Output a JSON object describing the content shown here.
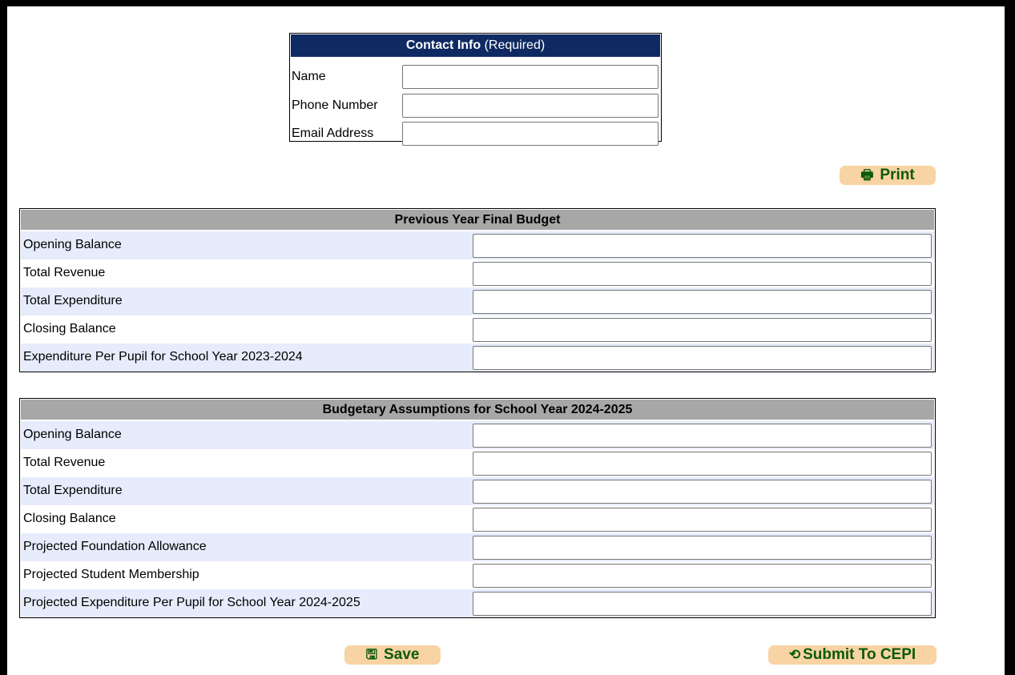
{
  "contact": {
    "title_bold": "Contact Info",
    "title_note": "(Required)",
    "fields": [
      {
        "label": "Name",
        "value": ""
      },
      {
        "label": "Phone Number",
        "value": ""
      },
      {
        "label": "Email Address",
        "value": ""
      }
    ]
  },
  "buttons": {
    "print": {
      "icon": "printer-icon",
      "label": "Print"
    },
    "save": {
      "icon": "floppy-disk-icon",
      "label": "Save"
    },
    "submit": {
      "icon": "refresh-arrow-icon",
      "label": "Submit To CEPI"
    }
  },
  "previous_year": {
    "title": "Previous Year Final Budget",
    "rows": [
      {
        "label": "Opening Balance",
        "value": ""
      },
      {
        "label": "Total Revenue",
        "value": ""
      },
      {
        "label": "Total Expenditure",
        "value": ""
      },
      {
        "label": "Closing Balance",
        "value": ""
      },
      {
        "label": "Expenditure Per Pupil for School Year 2023-2024",
        "value": ""
      }
    ]
  },
  "assumptions": {
    "title": "Budgetary Assumptions for School Year 2024-2025",
    "rows": [
      {
        "label": "Opening Balance",
        "value": ""
      },
      {
        "label": "Total Revenue",
        "value": ""
      },
      {
        "label": "Total Expenditure",
        "value": ""
      },
      {
        "label": "Closing Balance",
        "value": ""
      },
      {
        "label": "Projected Foundation Allowance",
        "value": ""
      },
      {
        "label": "Projected Student Membership",
        "value": ""
      },
      {
        "label": "Projected Expenditure Per Pupil for School Year 2024-2025",
        "value": ""
      }
    ]
  },
  "colors": {
    "contact_header": "#0f2a62",
    "table_header": "#a7a7a7",
    "row_alt": "#e6ecfb",
    "button_bg": "#f8d3a4",
    "button_text": "#0a5a0a"
  }
}
